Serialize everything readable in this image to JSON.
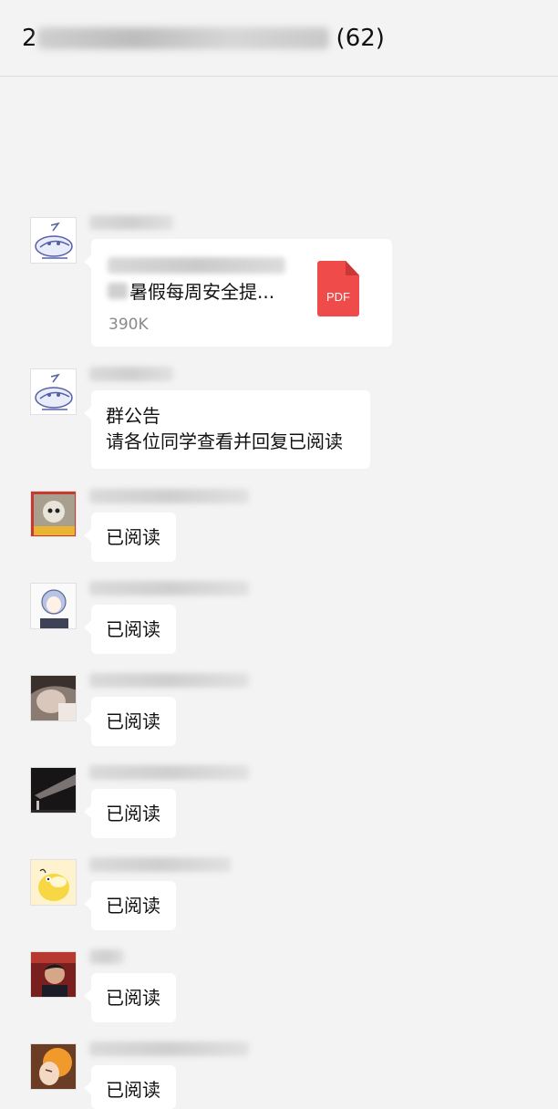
{
  "header": {
    "title_visible": "2",
    "member_count": "(62)"
  },
  "messages": [
    {
      "type": "file",
      "file": {
        "name": "暑假每周安全提...",
        "size": "390K",
        "type_label": "PDF"
      }
    },
    {
      "type": "notice",
      "lines": [
        "群公告",
        "请各位同学查看并回复已阅读"
      ]
    },
    {
      "type": "text",
      "text": "已阅读"
    },
    {
      "type": "text",
      "text": "已阅读"
    },
    {
      "type": "text",
      "text": "已阅读"
    },
    {
      "type": "text",
      "text": "已阅读"
    },
    {
      "type": "text",
      "text": "已阅读"
    },
    {
      "type": "text",
      "text": "已阅读"
    },
    {
      "type": "text",
      "text": "已阅读"
    }
  ]
}
